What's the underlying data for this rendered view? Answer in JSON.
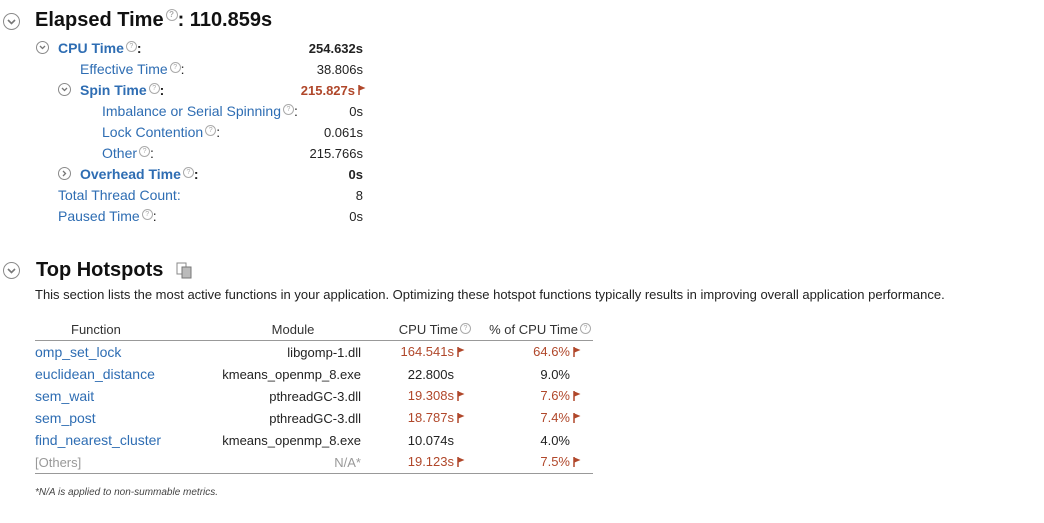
{
  "elapsed": {
    "title": "Elapsed Time",
    "value": ": 110.859s"
  },
  "metrics": {
    "cpu_time": {
      "label": "CPU Time",
      "value": "254.632s"
    },
    "effective_time": {
      "label": "Effective Time",
      "value": "38.806s"
    },
    "spin_time": {
      "label": "Spin Time",
      "value": "215.827s"
    },
    "imbalance": {
      "label": "Imbalance or Serial Spinning",
      "value": "0s"
    },
    "lock_contention": {
      "label": "Lock Contention",
      "value": "0.061s"
    },
    "other": {
      "label": "Other",
      "value": "215.766s"
    },
    "overhead_time": {
      "label": "Overhead Time",
      "value": "0s"
    },
    "thread_count": {
      "label": "Total Thread Count:",
      "value": "8"
    },
    "paused_time": {
      "label": "Paused Time",
      "value": "0s"
    }
  },
  "hotspots": {
    "title": "Top Hotspots",
    "description": "This section lists the most active functions in your application. Optimizing these hotspot functions typically results in improving overall application performance.",
    "headers": {
      "function": "Function",
      "module": "Module",
      "cpu_time": "CPU Time",
      "pct": "% of CPU Time"
    },
    "rows": [
      {
        "function": "omp_set_lock",
        "module": "libgomp-1.dll",
        "cpu_time": "164.541s",
        "pct": "64.6%",
        "flag": true
      },
      {
        "function": "euclidean_distance",
        "module": "kmeans_openmp_8.exe",
        "cpu_time": "22.800s",
        "pct": "9.0%",
        "flag": false
      },
      {
        "function": "sem_wait",
        "module": "pthreadGC-3.dll",
        "cpu_time": "19.308s",
        "pct": "7.6%",
        "flag": true
      },
      {
        "function": "sem_post",
        "module": "pthreadGC-3.dll",
        "cpu_time": "18.787s",
        "pct": "7.4%",
        "flag": true
      },
      {
        "function": "find_nearest_cluster",
        "module": "kmeans_openmp_8.exe",
        "cpu_time": "10.074s",
        "pct": "4.0%",
        "flag": false
      },
      {
        "function": "[Others]",
        "module": "N/A*",
        "cpu_time": "19.123s",
        "pct": "7.5%",
        "flag": true
      }
    ],
    "footnote": "*N/A is applied to non-summable metrics."
  },
  "help_glyph": "?",
  "colors": {
    "link": "#2e6db3",
    "flagged": "#b0472a"
  }
}
